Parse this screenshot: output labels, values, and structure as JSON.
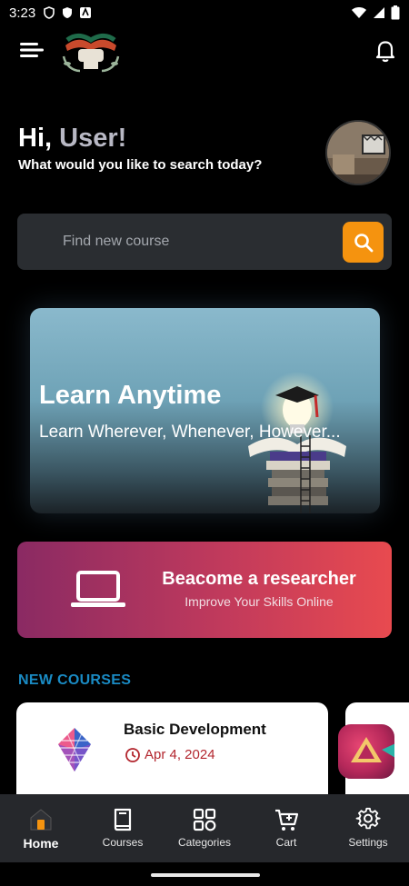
{
  "status_bar": {
    "time": "3:23"
  },
  "header": {
    "menu_icon": "menu-icon",
    "logo_icon": "book-logo",
    "notifications_icon": "bell-icon"
  },
  "greeting": {
    "hi": "Hi,",
    "name": "User!",
    "subtitle": "What would you like to search today?"
  },
  "search": {
    "placeholder": "Find new course",
    "value": ""
  },
  "banner": {
    "title": "Learn Anytime",
    "subtitle": "Learn Wherever, Whenever, However..."
  },
  "cta": {
    "title": "Beacome a researcher",
    "subtitle": "Improve Your Skills Online",
    "icon": "laptop-icon"
  },
  "new_courses": {
    "title": "NEW COURSES",
    "items": [
      {
        "title": "Basic Development",
        "date": "Apr 4, 2024"
      }
    ]
  },
  "bottom_nav": {
    "items": [
      {
        "label": "Home",
        "icon": "home-icon",
        "active": true
      },
      {
        "label": "Courses",
        "icon": "book-icon",
        "active": false
      },
      {
        "label": "Categories",
        "icon": "grid-icon",
        "active": false
      },
      {
        "label": "Cart",
        "icon": "cart-icon",
        "active": false
      },
      {
        "label": "Settings",
        "icon": "gear-icon",
        "active": false
      }
    ]
  },
  "colors": {
    "accent_orange": "#f5930f",
    "section_blue": "#1a8bc4",
    "date_red": "#b3262e",
    "nav_bg": "#26282c"
  }
}
